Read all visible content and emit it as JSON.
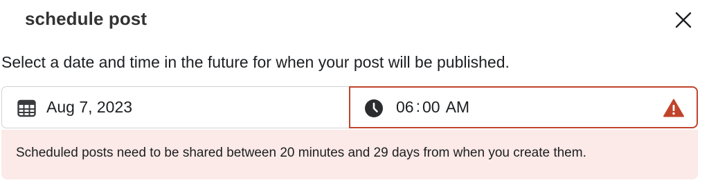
{
  "dialog": {
    "title": "schedule post",
    "subtitle": "Select a date and time in the future for when your post will be published.",
    "close_icon": "close-icon"
  },
  "date_picker": {
    "icon": "calendar-icon",
    "value": "Aug 7, 2023"
  },
  "time_picker": {
    "icon": "clock-icon",
    "hour": "06",
    "separator": ":",
    "minute": "00",
    "period": "AM",
    "status_icon": "warning-icon",
    "error_color": "#c0432b"
  },
  "error": {
    "message": "Scheduled posts need to be shared between 20 minutes and 29 days from when you create them.",
    "background": "#fbeae7"
  }
}
